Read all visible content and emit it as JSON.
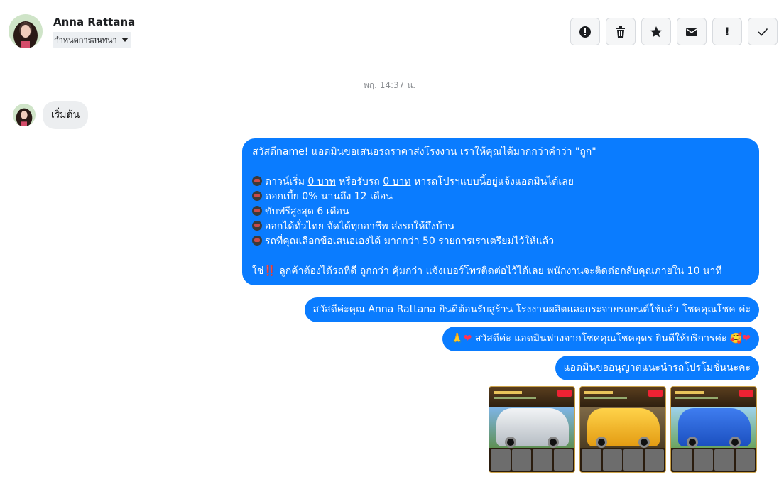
{
  "header": {
    "contact_name": "Anna Rattana",
    "label_select": "กำหนดการสนทนา",
    "actions": [
      {
        "name": "spam-button",
        "icon": "alert-circle-icon"
      },
      {
        "name": "delete-button",
        "icon": "trash-icon"
      },
      {
        "name": "star-button",
        "icon": "star-icon"
      },
      {
        "name": "mark-unread-button",
        "icon": "envelope-icon"
      },
      {
        "name": "important-button",
        "icon": "exclamation-icon",
        "glyph": "!"
      },
      {
        "name": "done-button",
        "icon": "check-icon"
      }
    ]
  },
  "conversation": {
    "timestamp": "พฤ. 14:37 น.",
    "incoming": {
      "text": "เริ่มต้น"
    },
    "outgoing_main": {
      "line1": "สวัสดีname! แอดมินขอเสนอรถราคาส่งโรงงาน เราให้คุณได้มากกว่าคำว่า \"ถูก\"",
      "l2_a": "ดาวน์เริ่ม ",
      "l2_b": "0 บาท",
      "l2_c": " หรือรับรถ ",
      "l2_d": "0 บาท",
      "l2_e": " หารถโปรฯแบบนี้อยู่แจ้งแอดมินได้เลย",
      "line3": "ดอกเบี้ย 0% นานถึง 12 เดือน",
      "line4": "ขับฟรีสูงสุด 6 เดือน",
      "line5": "ออกได้ทั่วไทย จัดได้ทุกอาชีพ ส่งรถให้ถึงบ้าน",
      "line6": "รถที่คุณเลือกข้อเสนอเองได้ มากกว่า 50 รายการเราเตรียมไว้ให้แล้ว",
      "l7_a": "ใช่",
      "l7_bang": "‼️",
      "l7_b": " ลูกค้าต้องได้รถที่ดี ถูกกว่า คุ้มกว่า แจ้งเบอร์โทรติดต่อไว้ได้เลย พนักงานจะติดต่อกลับคุณภายใน 10 นาที"
    },
    "outgoing_2": "สวัสดีค่ะคุณ Anna Rattana ยินดีต้อนรับสู่ร้าน โรงงานผลิตและกระจายรถยนต์ใช้แล้ว โชคคุณโชค ค่ะ",
    "outgoing_3": {
      "pre_emoji": "🙏",
      "heart": "❤",
      "text": " สวัสดีค่ะ แอดมินฟางจากโชคคุณโชคอุดร ยินดีให้บริการค่ะ ",
      "post_emoji": "🥰",
      "heart2": "❤"
    },
    "outgoing_4": "แอดมินขออนุญาตแนะนำรถโปรโมชั่นนะคะ",
    "photos": [
      "car-photo-silver-pickup",
      "car-photo-yellow-hatchback",
      "car-photo-blue-sedan"
    ]
  },
  "colors": {
    "bubble_out": "#0a7cff",
    "bubble_in": "#eceef0"
  }
}
